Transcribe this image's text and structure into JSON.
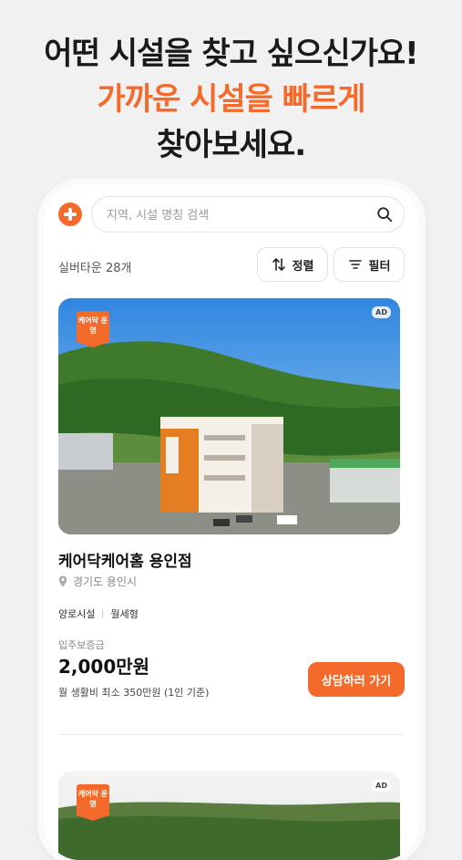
{
  "headline": {
    "line1": "어떤 시설을 찾고 싶으신가요!",
    "line2": "가까운 시설을 빠르게",
    "line3": "찾아보세요."
  },
  "search": {
    "placeholder": "지역, 시설 명칭 검색"
  },
  "list": {
    "count": "실버타운 28개",
    "sort_label": "정렬",
    "filter_label": "필터"
  },
  "cards": [
    {
      "badge": "케어닥 운영",
      "ad": "AD",
      "title": "케어닥케어홈 용인점",
      "location": "경기도 용인시",
      "type": "양로시설",
      "lease": "월세형",
      "deposit_label": "입주보증금",
      "price": "2,000만원",
      "monthly": "월 생활비 최소 350만원 (1인 기준)",
      "button": "상담하러 가기"
    },
    {
      "badge": "케어닥 운영",
      "ad": "AD"
    }
  ],
  "colors": {
    "accent": "#f36a2b"
  },
  "icons": [
    "plus-logo-icon",
    "search-icon",
    "sort-icon",
    "filter-icon",
    "location-pin-icon"
  ]
}
